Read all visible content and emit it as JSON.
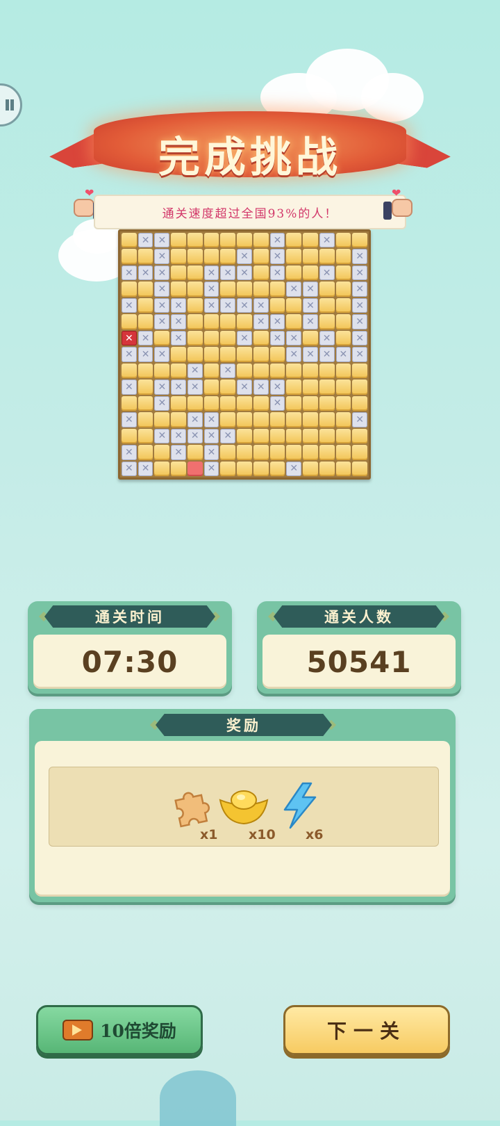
{
  "header": {
    "title": "完成挑战",
    "banner_text": "通关速度超过全国93%的人！"
  },
  "board": {
    "size": 15,
    "legend": {
      "f": "filled tile",
      "x": "crossed tile",
      "rx": "wrong cross",
      "r": "wrong fill"
    },
    "rows": [
      "fxxffffffxffxff",
      "ffxffffxfxffffx",
      "xxxffxxxfxffxfx",
      "ffxffxffffxxffx",
      "xfxxfxxxxffxffx",
      "ffxxffffxxfxffx",
      "rxfxfffxfxxfxfx",
      "xxxfffffffxxxxx",
      "ffffxfxffffffff",
      "xfxxxffxxxfffff",
      "ffxffffffxfffff",
      "xfffxxffffffffx",
      "ffxxxxxffffffff",
      "xffxfxfffffffff",
      "xxffrxffffxffff"
    ]
  },
  "stats": {
    "time_label": "通关时间",
    "time_value": "07:30",
    "players_label": "通关人数",
    "players_value": "50541"
  },
  "rewards": {
    "label": "奖励",
    "items": [
      {
        "icon": "puzzle-piece-icon",
        "count": "x1"
      },
      {
        "icon": "gold-ingot-icon",
        "count": "x10"
      },
      {
        "icon": "lightning-icon",
        "count": "x6"
      }
    ]
  },
  "buttons": {
    "double_reward": "10倍奖励",
    "next_level": "下一关"
  },
  "colors": {
    "background": "#b5ebe3",
    "ribbon": "#e25c38",
    "card": "#78c4a4",
    "tag": "#2f5c59",
    "tile": "#f2c455",
    "green_button": "#57b676",
    "yellow_button": "#f7cb62"
  }
}
